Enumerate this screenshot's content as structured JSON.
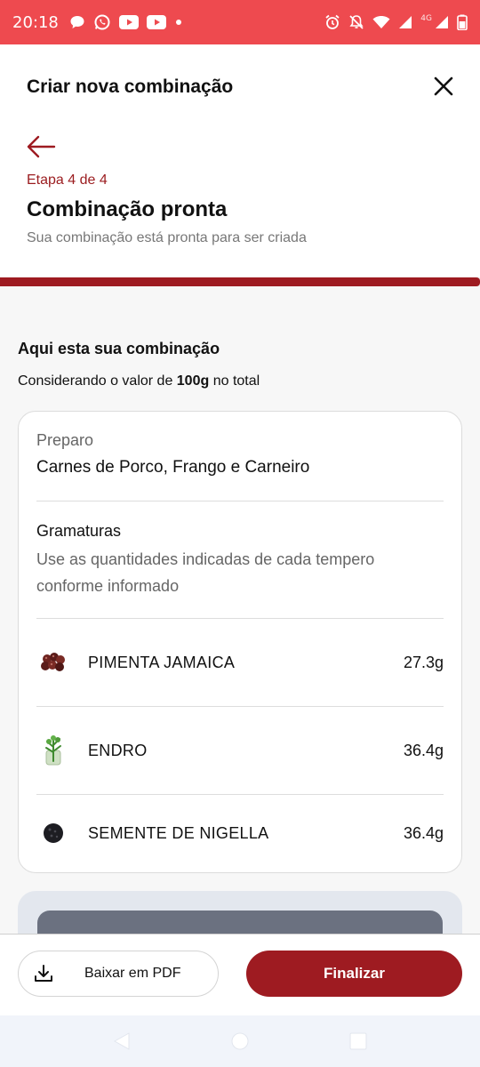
{
  "status_bar": {
    "time": "20:18",
    "network": "4G",
    "left_icons": [
      "chat-bubble-icon",
      "whatsapp-icon",
      "youtube-icon",
      "youtube-icon",
      "dot-icon"
    ],
    "right_icons": [
      "alarm-icon",
      "mute-icon",
      "wifi-icon",
      "signal-icon",
      "signal-icon",
      "battery-icon"
    ],
    "background_color": "#ee4a4f"
  },
  "header": {
    "title": "Criar nova combinação",
    "step_label": "Etapa 4 de 4",
    "step_title": "Combinação pronta",
    "step_subtitle": "Sua combinação está pronta para ser criada",
    "progress_fraction": 1.0,
    "accent_color": "#9e1b21"
  },
  "summary": {
    "title": "Aqui esta sua combinação",
    "desc_prefix": "Considerando o valor de ",
    "desc_bold": "100g",
    "desc_suffix": " no total"
  },
  "card": {
    "preparo_label": "Preparo",
    "preparo_value": "Carnes de Porco, Frango e Carneiro",
    "gramaturas_title": "Gramaturas",
    "gramaturas_desc": "Use as quantidades indicadas de cada tempero conforme informado",
    "spices": [
      {
        "name": "PIMENTA JAMAICA",
        "amount": "27.3g",
        "icon": "allspice-icon"
      },
      {
        "name": "ENDRO",
        "amount": "36.4g",
        "icon": "dill-icon"
      },
      {
        "name": "SEMENTE DE NIGELLA",
        "amount": "36.4g",
        "icon": "nigella-seed-icon"
      }
    ]
  },
  "footer": {
    "pdf_label": "Baixar em PDF",
    "finish_label": "Finalizar"
  }
}
